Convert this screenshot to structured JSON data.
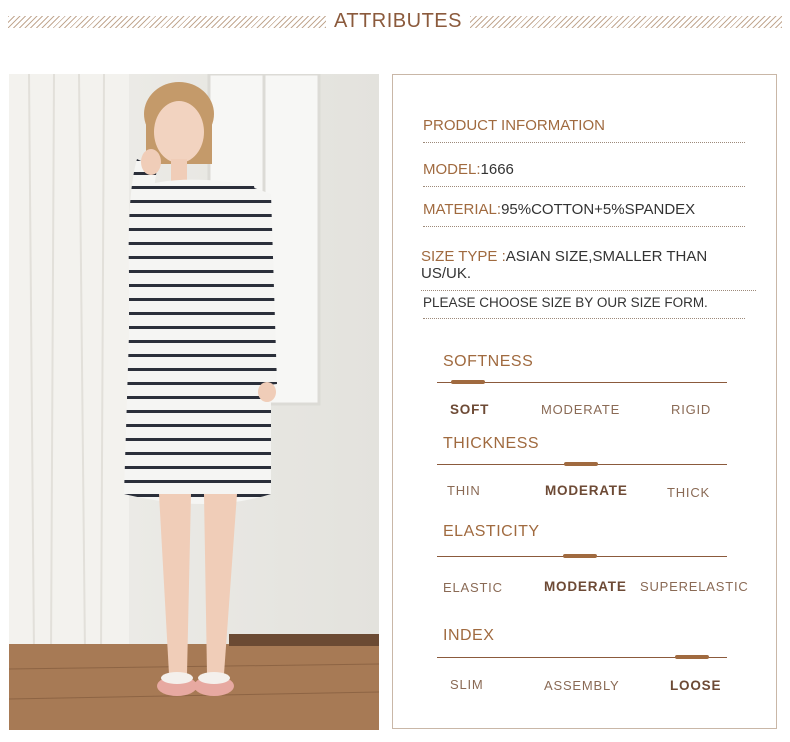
{
  "header": {
    "title": "ATTRIBUTES"
  },
  "product": {
    "section_title": "PRODUCT INFORMATION",
    "model": {
      "label": "MODEL:",
      "value": "1666"
    },
    "material": {
      "label": "MATERIAL:",
      "value": "95%COTTON+5%SPANDEX"
    },
    "size_type": {
      "label": "SIZE TYPE :",
      "value": "ASIAN SIZE,SMALLER THAN US/UK."
    },
    "note": "PLEASE CHOOSE SIZE BY OUR SIZE FORM."
  },
  "scales": [
    {
      "title": "SOFTNESS",
      "options": [
        "SOFT",
        "MODERATE",
        "RIGID"
      ],
      "selected": 0
    },
    {
      "title": "THICKNESS",
      "options": [
        "THIN",
        "MODERATE",
        "THICK"
      ],
      "selected": 1
    },
    {
      "title": "ELASTICITY",
      "options": [
        "ELASTIC",
        "MODERATE",
        "SUPERELASTIC"
      ],
      "selected": 1
    },
    {
      "title": "INDEX",
      "options": [
        "SLIM",
        "ASSEMBLY",
        "LOOSE"
      ],
      "selected": 2
    }
  ],
  "colors": {
    "accent": "#a06a3f",
    "dark_accent": "#8b5a3c",
    "border": "#c9b7a7"
  }
}
